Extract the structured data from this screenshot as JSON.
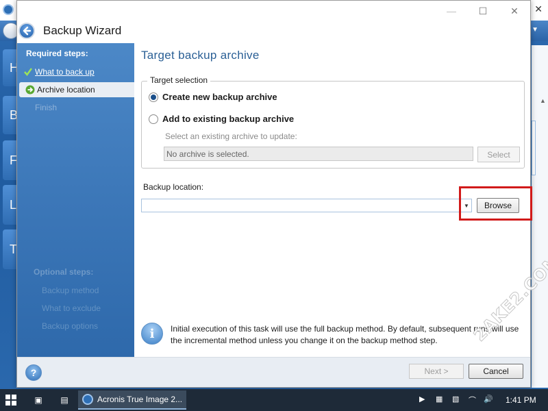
{
  "background_app": {
    "left_tiles": [
      "H",
      "B",
      "F",
      "L",
      "T"
    ]
  },
  "dialog": {
    "title": "Backup Wizard",
    "controls": {
      "minimize": "—",
      "maximize": "☐",
      "close": "✕"
    }
  },
  "steps": {
    "required_heading": "Required steps:",
    "required": [
      {
        "label": "What to back up",
        "state": "done"
      },
      {
        "label": "Archive location",
        "state": "current"
      },
      {
        "label": "Finish",
        "state": "future"
      }
    ],
    "optional_heading": "Optional steps:",
    "optional": [
      "Backup method",
      "What to exclude",
      "Backup options"
    ]
  },
  "content": {
    "title": "Target backup archive",
    "target_selection": {
      "legend": "Target selection",
      "options": [
        {
          "label": "Create new backup archive",
          "checked": true
        },
        {
          "label": "Add to existing backup archive",
          "checked": false
        }
      ],
      "existing_label": "Select an existing archive to update:",
      "existing_value": "No archive is selected.",
      "select_button": "Select"
    },
    "backup_location": {
      "label": "Backup location:",
      "value": "",
      "browse_button": "Browse"
    },
    "info_text": "Initial execution of this task will use the full backup method. By default, subsequent runs will use the incremental method unless you change it on the backup method step."
  },
  "footer": {
    "help": "?",
    "next_button": "Next >",
    "cancel_button": "Cancel"
  },
  "watermark": "2AKE2.COM",
  "taskbar": {
    "app_label": "Acronis True Image 2...",
    "clock": "1:41 PM"
  },
  "colors": {
    "accent": "#2a5f95",
    "highlight": "#d11a1a",
    "steps_panel": "#3c77b8"
  }
}
